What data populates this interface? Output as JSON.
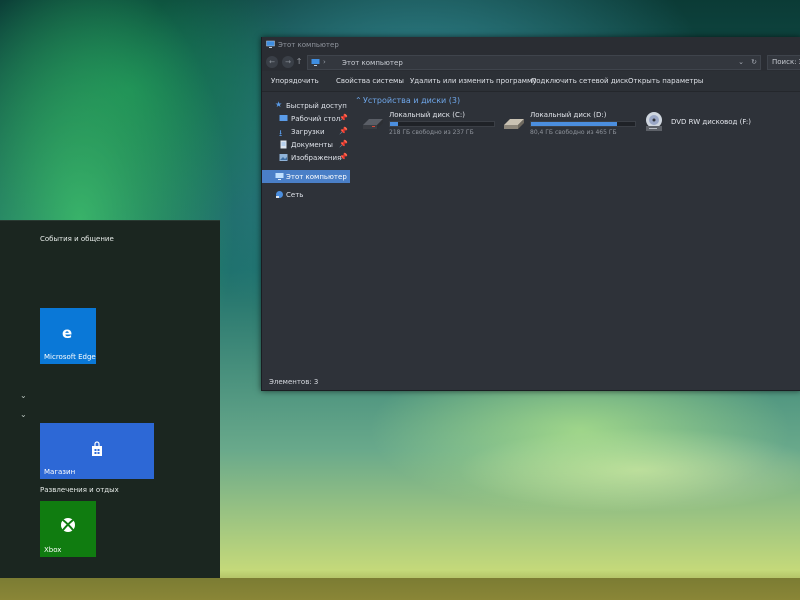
{
  "start_menu": {
    "group1_title": "События и общение",
    "group2_title": "Развлечения и отдых",
    "tiles": {
      "edge": {
        "label": "Microsoft Edge",
        "color": "#0a78d7"
      },
      "store": {
        "label": "Магазин",
        "color": "#2d68d6"
      },
      "xbox": {
        "label": "Xbox",
        "color": "#107c10"
      }
    }
  },
  "explorer": {
    "title": "Этот компьютер",
    "address": {
      "path_label": "Этот компьютер",
      "search_placeholder": "Поиск: Эт"
    },
    "toolbar": {
      "organize": "Упорядочить",
      "system_properties": "Свойства системы",
      "uninstall": "Удалить или изменить программу",
      "map_drive": "Подключить сетевой диск",
      "open_settings": "Открыть параметры"
    },
    "nav": {
      "quick_access": "Быстрый доступ",
      "desktop": "Рабочий стол",
      "downloads": "Загрузки",
      "documents": "Документы",
      "pictures": "Изображения",
      "this_pc": "Этот компьютер",
      "network": "Сеть"
    },
    "group_title": "Устройства и диски (3)",
    "drives": {
      "c": {
        "name": "Локальный диск (C:)",
        "info": "218 ГБ свободно из 237 ГБ",
        "used_fraction": 0.08
      },
      "d": {
        "name": "Локальный диск (D:)",
        "info": "80,4 ГБ свободно из 465 ГБ",
        "used_fraction": 0.83
      },
      "f": {
        "name": "DVD RW дисковод (F:)"
      }
    },
    "status": "Элементов: 3"
  },
  "colors": {
    "accent": "#4a7fc7",
    "window_bg": "#2e3239",
    "start_bg": "#1b2620"
  }
}
